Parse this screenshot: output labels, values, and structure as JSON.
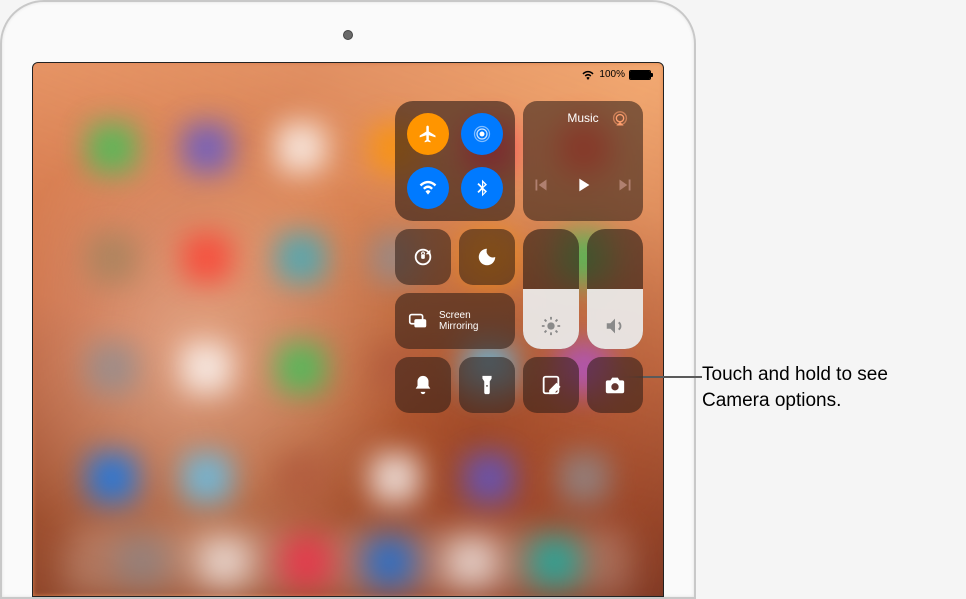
{
  "status": {
    "battery_percent": "100%",
    "wifi_connected": true
  },
  "control_center": {
    "connectivity": {
      "airplane": {
        "on": true,
        "name": "airplane-mode-icon",
        "bg": "#ff9500"
      },
      "airdrop": {
        "on": true,
        "name": "airdrop-icon",
        "bg": "#007aff"
      },
      "wifi": {
        "on": true,
        "name": "wifi-icon",
        "bg": "#007aff"
      },
      "bluetooth": {
        "on": true,
        "name": "bluetooth-icon",
        "bg": "#007aff"
      }
    },
    "music": {
      "label": "Music",
      "playing": false,
      "airplay_available": true
    },
    "orientation_lock": {
      "on": false
    },
    "do_not_disturb": {
      "on": false
    },
    "screen_mirroring": {
      "label": "Screen\nMirroring"
    },
    "brightness_percent": 50,
    "volume_percent": 50,
    "shortcuts": {
      "silent": {
        "name": "silent-icon"
      },
      "flashlight": {
        "name": "flashlight-icon"
      },
      "notes": {
        "name": "notes-icon"
      },
      "camera": {
        "name": "camera-icon"
      }
    }
  },
  "callout": {
    "text": "Touch and hold to see Camera options."
  }
}
